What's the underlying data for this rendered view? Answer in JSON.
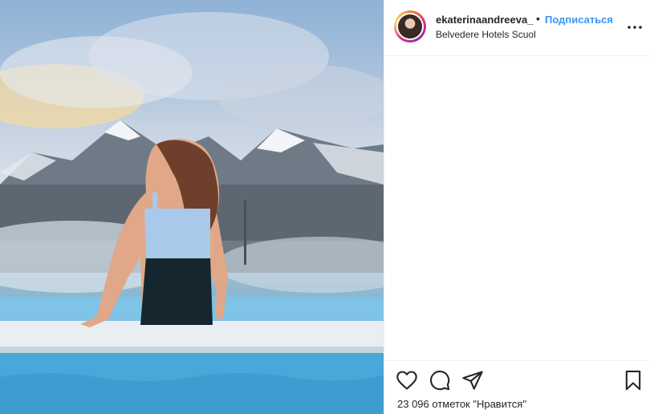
{
  "post": {
    "username": "ekaterinaandreeva_",
    "separator": "•",
    "follow_label": "Подписаться",
    "location": "Belvedere Hotels Scuol",
    "likes_text": "23 096 отметок \"Нравится\""
  },
  "icons": {
    "avatar": "profile-avatar",
    "more": "more-options-icon",
    "like": "heart-icon",
    "comment": "comment-icon",
    "share": "share-icon",
    "save": "bookmark-icon"
  },
  "colors": {
    "follow": "#3897f0",
    "text": "#262626",
    "divider": "#efefef"
  }
}
